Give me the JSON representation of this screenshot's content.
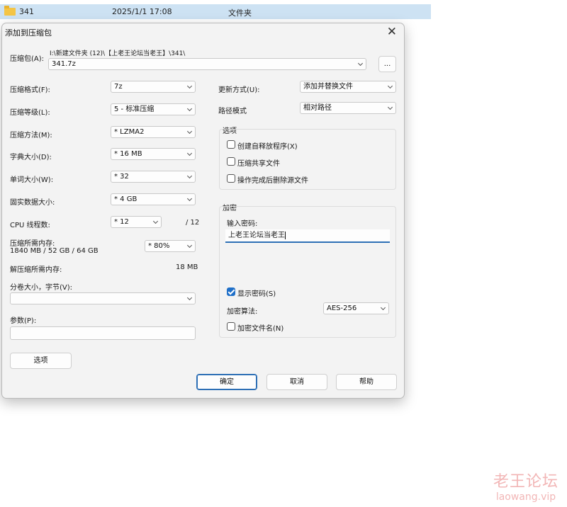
{
  "explorer": {
    "name": "341",
    "date": "2025/1/1 17:08",
    "type": "文件夹"
  },
  "dialog": {
    "title": "添加到压缩包",
    "archive_label": "压缩包(A):",
    "archive_path": "I:\\新建文件夹 (12)\\【上老王论坛当老王】\\341\\",
    "archive_name": "341.7z",
    "browse_label": "...",
    "format_label": "压缩格式(F):",
    "format_value": "7z",
    "level_label": "压缩等级(L):",
    "level_value": "5 - 标准压缩",
    "method_label": "压缩方法(M):",
    "method_value": "* LZMA2",
    "dict_label": "字典大小(D):",
    "dict_value": "* 16 MB",
    "word_label": "单词大小(W):",
    "word_value": "* 32",
    "solid_label": "固实数据大小:",
    "solid_value": "* 4 GB",
    "cpu_label": "CPU 线程数:",
    "cpu_value": "* 12",
    "cpu_max": "/ 12",
    "mem_label": "压缩所需内存:",
    "mem_detail": "1840 MB / 52 GB / 64 GB",
    "mem_value": "* 80%",
    "decomp_label": "解压缩所需内存:",
    "decomp_value": "18 MB",
    "split_label": "分卷大小，字节(V):",
    "split_value": "",
    "params_label": "参数(P):",
    "params_value": "",
    "options_button": "选项",
    "update_label": "更新方式(U):",
    "update_value": "添加并替换文件",
    "pathmode_label": "路径模式",
    "pathmode_value": "相对路径",
    "options_group": "选项",
    "opt_sfx": "创建自释放程序(X)",
    "opt_shared": "压缩共享文件",
    "opt_delete": "操作完成后删除源文件",
    "enc_group": "加密",
    "pwd_label": "输入密码:",
    "pwd_value": "上老王论坛当老王",
    "show_pwd": "显示密码(S)",
    "enc_method_label": "加密算法:",
    "enc_method_value": "AES-256",
    "enc_names": "加密文件名(N)",
    "ok": "确定",
    "cancel": "取消",
    "help": "帮助"
  },
  "watermark": {
    "line1": "老王论坛",
    "line2": "laowang.vip"
  }
}
